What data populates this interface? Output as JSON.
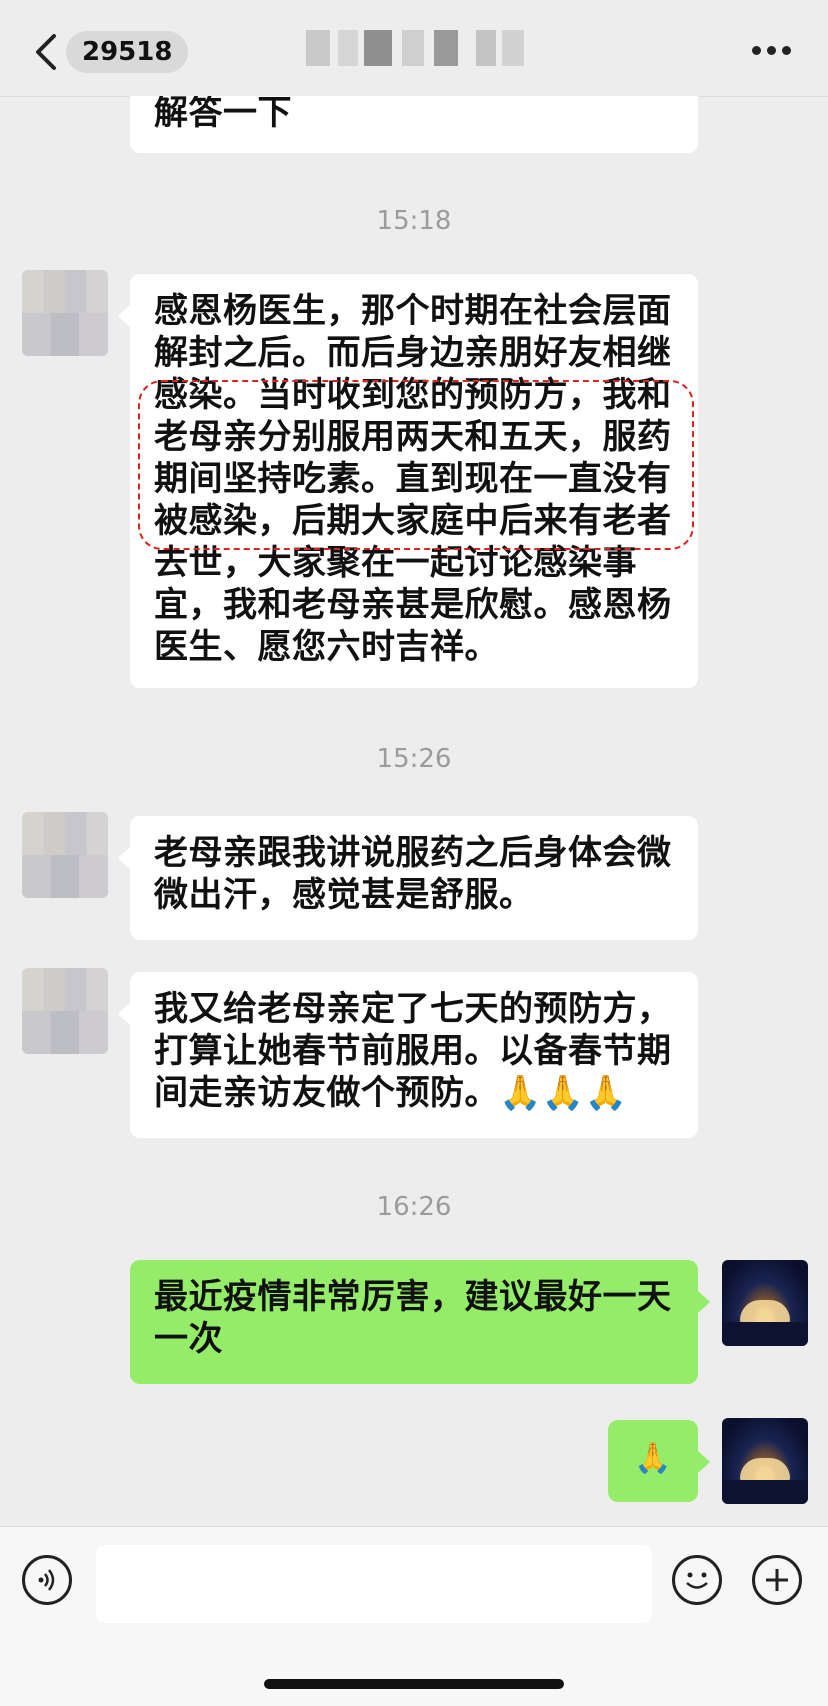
{
  "header": {
    "badge_count": "29518",
    "more_icon": "ellipsis-icon"
  },
  "messages": {
    "top_partial": "解答一下",
    "ts1": "15:18",
    "msg1_lines": [
      "感恩杨医生，那个时期在社会层面",
      "解封之后。而后身边亲朋好友相继",
      "感染。当时收到您的预防方，我和",
      "老母亲分别服用两天和五天，服药",
      "期间坚持吃素。直到现在一直没有",
      "被感染，后期大家庭中后来有老者",
      "去世，大家聚在一起讨论感染事",
      "宜，我和老母亲甚是欣慰。感恩杨",
      "医生、愿您六时吉祥。"
    ],
    "ts2": "15:26",
    "msg2_lines": [
      "老母亲跟我讲说服药之后身体会微",
      "微出汗，感觉甚是舒服。"
    ],
    "msg3_lines": [
      "我又给老母亲定了七天的预防方，",
      "打算让她春节前服用。以备春节期",
      "间走亲访友做个预防。🙏🙏🙏"
    ],
    "ts3": "16:26",
    "msg4_lines": [
      "最近疫情非常厉害，建议最好一天",
      "一次"
    ],
    "msg5": "🙏"
  },
  "colors": {
    "background": "#ededed",
    "sent_bubble": "#95ec69",
    "received_bubble": "#ffffff",
    "highlight_dash": "#d9241f"
  }
}
